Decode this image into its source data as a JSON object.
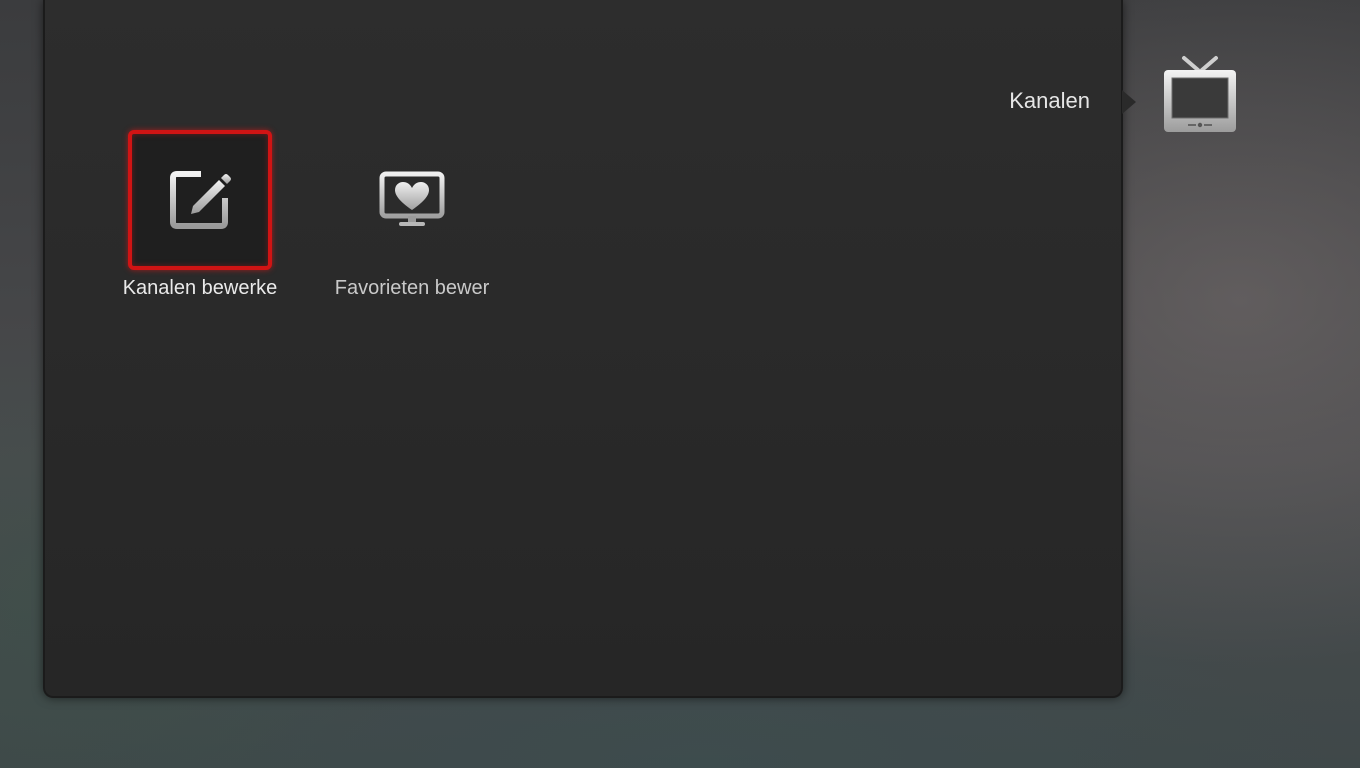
{
  "header": {
    "section_title": "Kanalen",
    "section_icon": "tv-icon"
  },
  "menu": {
    "items": [
      {
        "label": "Kanalen bewerke",
        "icon": "edit-pencil-icon",
        "selected": true
      },
      {
        "label": "Favorieten bewer",
        "icon": "monitor-heart-icon",
        "selected": false
      }
    ]
  },
  "colors": {
    "selection_border": "#d01414",
    "panel_background": "#2a2a2a",
    "text": "#eaeaea"
  }
}
